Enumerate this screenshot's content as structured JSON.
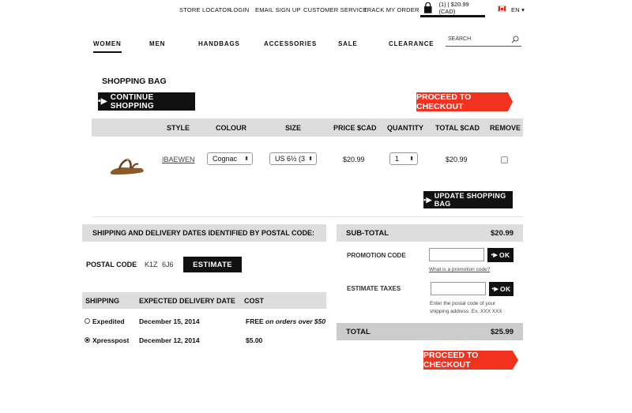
{
  "utility_nav": [
    "STORE LOCATOR",
    "LOGIN",
    "EMAIL SIGN UP",
    "CUSTOMER SERVICE",
    "TRACK MY ORDER"
  ],
  "cart_summary": "(1) | $20.99 (CAD)",
  "language": "EN",
  "main_nav": [
    "WOMEN",
    "MEN",
    "HANDBAGS",
    "ACCESSORIES",
    "SALE",
    "CLEARANCE"
  ],
  "search_placeholder": "SEARCH",
  "page_title": "SHOPPING BAG",
  "continue_label": "CONTINUE SHOPPING",
  "checkout_label": "PROCEED TO CHECKOUT",
  "columns": [
    "STYLE",
    "COLOUR",
    "SIZE",
    "PRICE $CAD",
    "QUANTITY",
    "TOTAL $CAD",
    "REMOVE"
  ],
  "item": {
    "style": "IBAEWEN",
    "colour": "Cognac",
    "size": "US 6½ (3",
    "price": "$20.99",
    "quantity": "1",
    "total": "$20.99"
  },
  "update_label": "UPDATE SHOPPING BAG",
  "shipping": {
    "heading": "SHIPPING AND DELIVERY DATES IDENTIFIED BY POSTAL CODE:",
    "postal_label": "POSTAL CODE",
    "postal_1": "K1Z",
    "postal_2": "6J6",
    "estimate_label": "ESTIMATE",
    "headers": [
      "SHIPPING",
      "EXPECTED DELIVERY DATE",
      "COST"
    ],
    "options": [
      {
        "name": "Expedited",
        "date": "December 15, 2014",
        "cost": "FREE",
        "note": "on orders over $50",
        "selected": false
      },
      {
        "name": "Xpresspost",
        "date": "December 12, 2014",
        "cost": "$5.00",
        "note": "",
        "selected": true
      }
    ]
  },
  "summary": {
    "subtotal_label": "SUB-TOTAL",
    "subtotal": "$20.99",
    "promo_label": "PROMOTION CODE",
    "ok_label": "OK",
    "promo_link": "What is a promotion code?",
    "taxes_label": "ESTIMATE TAXES",
    "tax_hint_1": "Enter the postal code of your",
    "tax_hint_2": "shipping address. Ex. XXX XXX",
    "total_label": "TOTAL",
    "total": "$25.99"
  }
}
